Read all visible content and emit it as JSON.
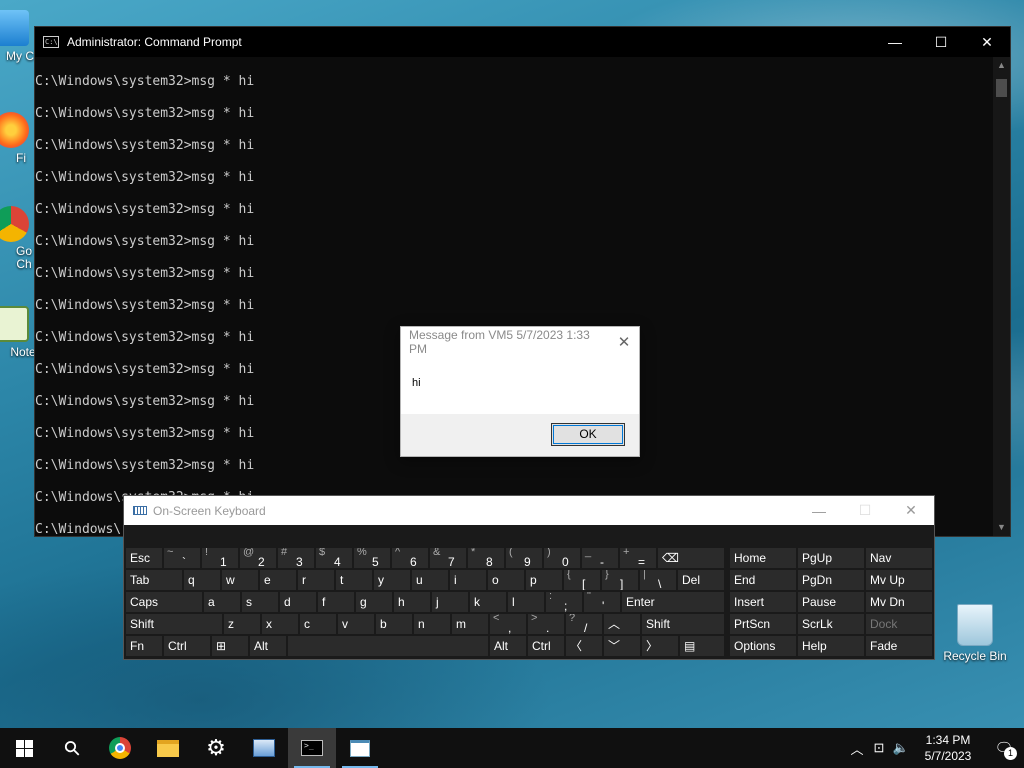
{
  "desktop": {
    "icons": [
      {
        "label": "My Co"
      },
      {
        "label": "Fi"
      },
      {
        "label": "Go\nCh"
      },
      {
        "label": "Note"
      },
      {
        "label": "Recycle Bin"
      }
    ]
  },
  "cmd_window": {
    "title": "Administrator: Command Prompt",
    "icon_text": "C:\\",
    "lines": [
      "C:\\Windows\\system32>msg * hi",
      "",
      "C:\\Windows\\system32>msg * hi",
      "",
      "C:\\Windows\\system32>msg * hi",
      "",
      "C:\\Windows\\system32>msg * hi",
      "",
      "C:\\Windows\\system32>msg * hi",
      "",
      "C:\\Windows\\system32>msg * hi",
      "",
      "C:\\Windows\\system32>msg * hi",
      "",
      "C:\\Windows\\system32>msg * hi",
      "",
      "C:\\Windows\\system32>msg * hi",
      "",
      "C:\\Windows\\system32>msg * hi",
      "",
      "C:\\Windows\\system32>msg * hi",
      "",
      "C:\\Windows\\system32>msg * hi",
      "",
      "C:\\Windows\\system32>msg * hi",
      "",
      "C:\\Windows\\system32>msg * hi",
      "",
      "C:\\Windows\\"
    ],
    "minimize": "—",
    "maximize": "☐",
    "close": "✕"
  },
  "message_box": {
    "title": "Message from VM5 5/7/2023 1:33 PM",
    "text": "hi",
    "ok_label": "OK",
    "close": "✕"
  },
  "osk": {
    "title": "On-Screen Keyboard",
    "minimize": "—",
    "maximize": "☐",
    "close": "✕",
    "keys": {
      "esc": "Esc",
      "tilde_sh": "~",
      "tilde": "`",
      "k1_sh": "!",
      "k1": "1",
      "k2_sh": "@",
      "k2": "2",
      "k3_sh": "#",
      "k3": "3",
      "k4_sh": "$",
      "k4": "4",
      "k5_sh": "%",
      "k5": "5",
      "k6_sh": "^",
      "k6": "6",
      "k7_sh": "&",
      "k7": "7",
      "k8_sh": "*",
      "k8": "8",
      "k9_sh": "(",
      "k9": "9",
      "k0_sh": ")",
      "k0": "0",
      "minus_sh": "_",
      "minus": "-",
      "eq_sh": "+",
      "eq": "=",
      "bksp": "⌫",
      "tab": "Tab",
      "q": "q",
      "w": "w",
      "e": "e",
      "r": "r",
      "t": "t",
      "y": "y",
      "u": "u",
      "i": "i",
      "o": "o",
      "p": "p",
      "lbr_sh": "{",
      "lbr": "[",
      "rbr_sh": "}",
      "rbr": "]",
      "bsl_sh": "|",
      "bsl": "\\",
      "del": "Del",
      "caps": "Caps",
      "a": "a",
      "s": "s",
      "d": "d",
      "f": "f",
      "g": "g",
      "h": "h",
      "j": "j",
      "k": "k",
      "l": "l",
      "semi_sh": ":",
      "semi": ";",
      "quote_sh": "\"",
      "quote": "'",
      "enter": "Enter",
      "shift_l": "Shift",
      "z": "z",
      "x": "x",
      "c": "c",
      "v": "v",
      "b": "b",
      "n": "n",
      "m": "m",
      "comma_sh": "<",
      "comma": ",",
      "dot_sh": ">",
      "dot": ".",
      "slash_sh": "?",
      "slash": "/",
      "up": "︿",
      "shift_r": "Shift",
      "fn": "Fn",
      "ctrl_l": "Ctrl",
      "win": "⊞",
      "alt_l": "Alt",
      "alt_r": "Alt",
      "ctrl_r": "Ctrl",
      "left": "〈",
      "down": "﹀",
      "right": "〉",
      "menu": "▤",
      "home": "Home",
      "pgup": "PgUp",
      "nav": "Nav",
      "end": "End",
      "pgdn": "PgDn",
      "mvup": "Mv Up",
      "insert": "Insert",
      "pause": "Pause",
      "mvdn": "Mv Dn",
      "prtscn": "PrtScn",
      "scrlk": "ScrLk",
      "dock": "Dock",
      "options": "Options",
      "help": "Help",
      "fade": "Fade"
    }
  },
  "taskbar": {
    "start_icon": "windows-logo",
    "search_icon": "⚲",
    "apps": [
      "chrome",
      "file-explorer",
      "settings",
      "network-app",
      "command-prompt",
      "notepad-app"
    ],
    "tray": {
      "chevron": "︿",
      "network": "⊡",
      "volume": "🔈"
    },
    "time": "1:34 PM",
    "date": "5/7/2023",
    "notification_count": "1"
  }
}
